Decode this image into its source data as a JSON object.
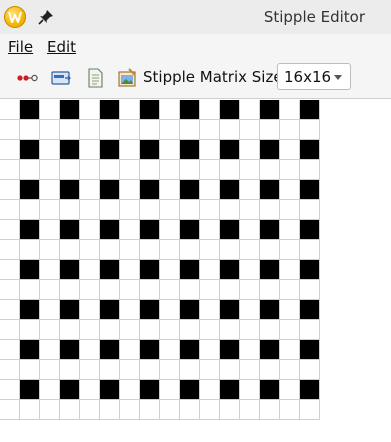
{
  "window": {
    "title": "Stipple Editor"
  },
  "menu": {
    "file_label": "File",
    "edit_label": "Edit"
  },
  "toolbar": {
    "icons": [
      "points-icon",
      "pattern-icon",
      "document-icon",
      "picture-icon"
    ],
    "matrix_label": "Stipple Matrix Size:",
    "matrix_size": "16x16"
  },
  "stipple": {
    "rows": 16,
    "cols": 16,
    "pattern": [
      "0101010101010101",
      "0000000000000000",
      "0101010101010101",
      "0000000000000000",
      "0101010101010101",
      "0000000000000000",
      "0101010101010101",
      "0000000000000000",
      "0101010101010101",
      "0000000000000000",
      "0101010101010101",
      "0000000000000000",
      "0101010101010101",
      "0000000000000000",
      "0101010101010101",
      "0000000000000000"
    ]
  },
  "colors": {
    "on": "#000000",
    "off": "#ffffff",
    "grid_line": "#cfcfcf"
  }
}
